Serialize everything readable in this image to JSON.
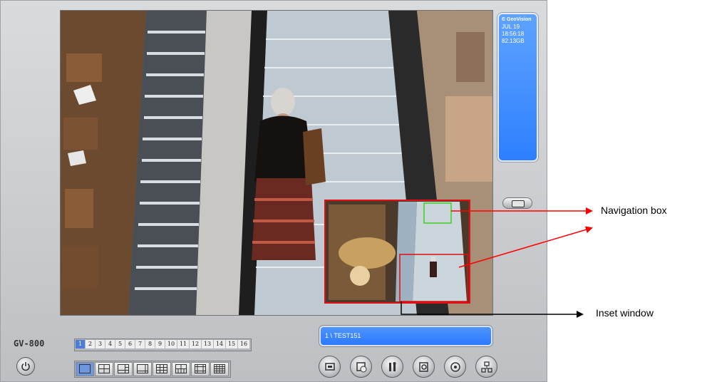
{
  "status": {
    "brand": "GeoVision",
    "date": "JUL 19",
    "time": "18:56:18",
    "disk": "82.13GB"
  },
  "model": "GV-800",
  "camera_tabs": [
    "1",
    "2",
    "3",
    "4",
    "5",
    "6",
    "7",
    "8",
    "9",
    "10",
    "11",
    "12",
    "13",
    "14",
    "15",
    "16"
  ],
  "active_camera": "1",
  "camera_name": "1 \\ TEST151",
  "layout_buttons": [
    "1-view",
    "4-view",
    "6-view",
    "8-view",
    "9-view",
    "10-view",
    "13-view",
    "16-view"
  ],
  "toolbar_buttons": [
    "monitor-icon",
    "schedule-icon",
    "config-icon",
    "viewlog-icon",
    "pan-icon",
    "network-icon"
  ],
  "callouts": {
    "navigation_box": "Navigation box",
    "inset_window": "Inset window"
  },
  "colors": {
    "panel_blue": "#2d7fff",
    "inset_border": "#e01010",
    "nav_box": "#40d020",
    "arrow_red": "#ff0000"
  }
}
